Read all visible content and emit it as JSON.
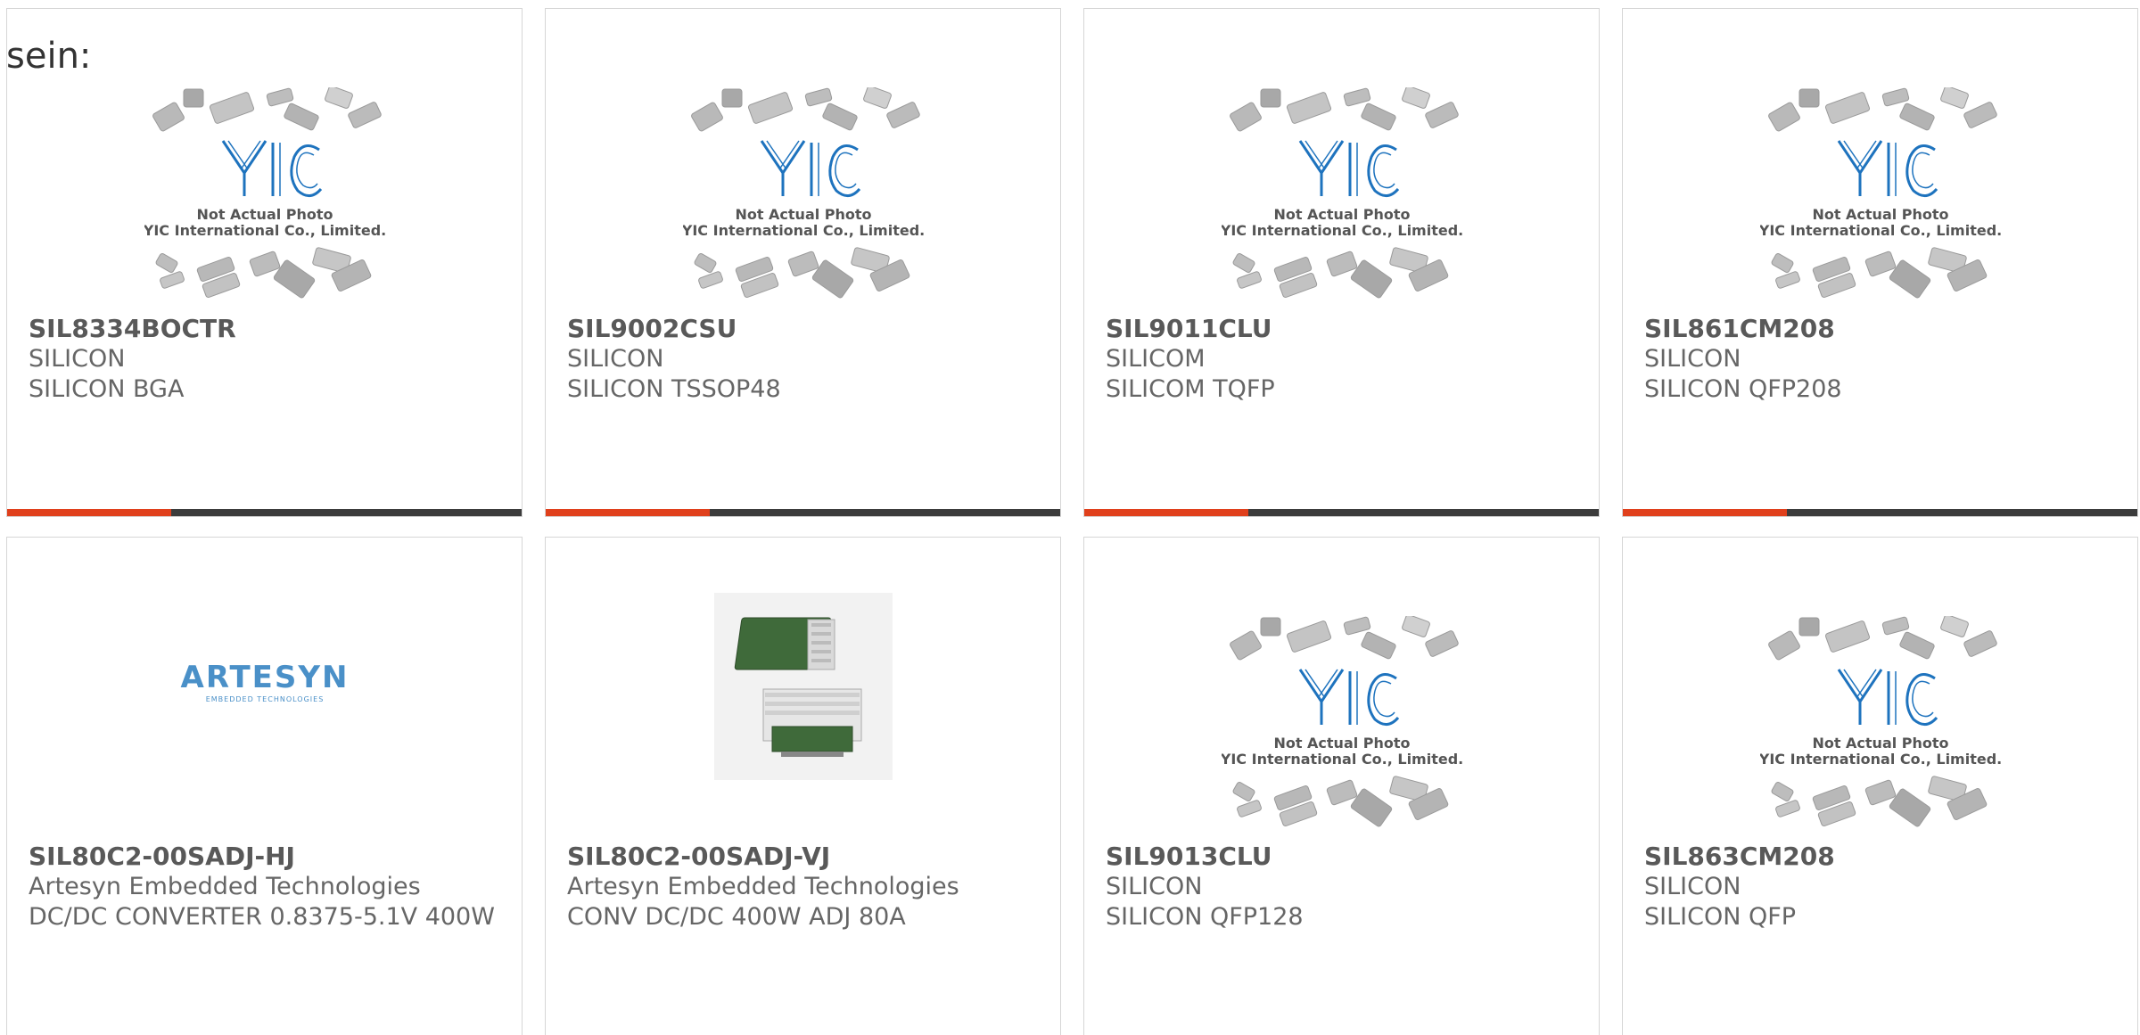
{
  "page": {
    "lead_text": "sein:"
  },
  "colors": {
    "accent_red": "#e0401c",
    "accent_dark": "#3c3c3c",
    "card_border": "#d6d6d6",
    "text": "#5a5a5a",
    "yic_blue": "#1e73be"
  },
  "products": [
    {
      "part": "SIL8334BOCTR",
      "manufacturer": "SILICON",
      "description": "SILICON BGA",
      "image": "yic-placeholder",
      "placeholder_line1": "Not Actual Photo",
      "placeholder_line2": "YIC International Co., Limited."
    },
    {
      "part": "SIL9002CSU",
      "manufacturer": "SILICON",
      "description": "SILICON TSSOP48",
      "image": "yic-placeholder",
      "placeholder_line1": "Not Actual Photo",
      "placeholder_line2": "YIC International Co., Limited."
    },
    {
      "part": "SIL9011CLU",
      "manufacturer": "SILICOM",
      "description": "SILICOM TQFP",
      "image": "yic-placeholder",
      "placeholder_line1": "Not Actual Photo",
      "placeholder_line2": "YIC International Co., Limited."
    },
    {
      "part": "SIL861CM208",
      "manufacturer": "SILICON",
      "description": "SILICON QFP208",
      "image": "yic-placeholder",
      "placeholder_line1": "Not Actual Photo",
      "placeholder_line2": "YIC International Co., Limited."
    },
    {
      "part": "SIL80C2-00SADJ-HJ",
      "manufacturer": "Artesyn Embedded Technologies",
      "description": "DC/DC CONVERTER 0.8375-5.1V 400W",
      "image": "artesyn-logo",
      "logo_text": "ARTESYN",
      "logo_subtext": "EMBEDDED TECHNOLOGIES"
    },
    {
      "part": "SIL80C2-00SADJ-VJ",
      "manufacturer": "Artesyn Embedded Technologies",
      "description": "CONV DC/DC 400W ADJ 80A",
      "image": "converter-photo"
    },
    {
      "part": "SIL9013CLU",
      "manufacturer": "SILICON",
      "description": "SILICON QFP128",
      "image": "yic-placeholder",
      "placeholder_line1": "Not Actual Photo",
      "placeholder_line2": "YIC International Co., Limited."
    },
    {
      "part": "SIL863CM208",
      "manufacturer": "SILICON",
      "description": "SILICON QFP",
      "image": "yic-placeholder",
      "placeholder_line1": "Not Actual Photo",
      "placeholder_line2": "YIC International Co., Limited."
    }
  ]
}
